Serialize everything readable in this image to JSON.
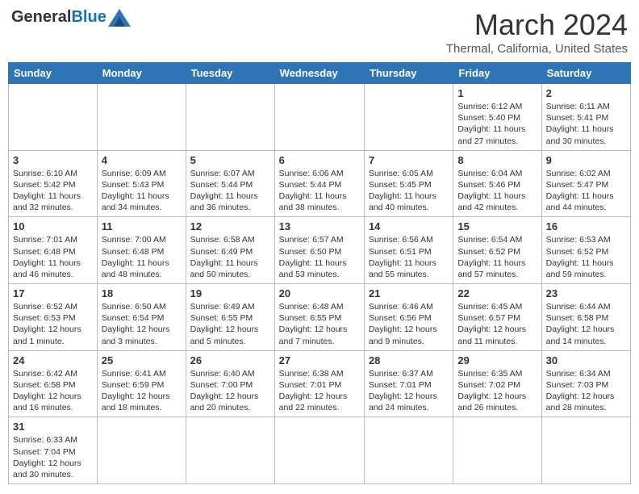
{
  "header": {
    "logo": {
      "general": "General",
      "blue": "Blue"
    },
    "title": "March 2024",
    "location": "Thermal, California, United States"
  },
  "weekdays": [
    "Sunday",
    "Monday",
    "Tuesday",
    "Wednesday",
    "Thursday",
    "Friday",
    "Saturday"
  ],
  "weeks": [
    [
      {
        "day": "",
        "info": ""
      },
      {
        "day": "",
        "info": ""
      },
      {
        "day": "",
        "info": ""
      },
      {
        "day": "",
        "info": ""
      },
      {
        "day": "",
        "info": ""
      },
      {
        "day": "1",
        "info": "Sunrise: 6:12 AM\nSunset: 5:40 PM\nDaylight: 11 hours and 27 minutes."
      },
      {
        "day": "2",
        "info": "Sunrise: 6:11 AM\nSunset: 5:41 PM\nDaylight: 11 hours and 30 minutes."
      }
    ],
    [
      {
        "day": "3",
        "info": "Sunrise: 6:10 AM\nSunset: 5:42 PM\nDaylight: 11 hours and 32 minutes."
      },
      {
        "day": "4",
        "info": "Sunrise: 6:09 AM\nSunset: 5:43 PM\nDaylight: 11 hours and 34 minutes."
      },
      {
        "day": "5",
        "info": "Sunrise: 6:07 AM\nSunset: 5:44 PM\nDaylight: 11 hours and 36 minutes."
      },
      {
        "day": "6",
        "info": "Sunrise: 6:06 AM\nSunset: 5:44 PM\nDaylight: 11 hours and 38 minutes."
      },
      {
        "day": "7",
        "info": "Sunrise: 6:05 AM\nSunset: 5:45 PM\nDaylight: 11 hours and 40 minutes."
      },
      {
        "day": "8",
        "info": "Sunrise: 6:04 AM\nSunset: 5:46 PM\nDaylight: 11 hours and 42 minutes."
      },
      {
        "day": "9",
        "info": "Sunrise: 6:02 AM\nSunset: 5:47 PM\nDaylight: 11 hours and 44 minutes."
      }
    ],
    [
      {
        "day": "10",
        "info": "Sunrise: 7:01 AM\nSunset: 6:48 PM\nDaylight: 11 hours and 46 minutes."
      },
      {
        "day": "11",
        "info": "Sunrise: 7:00 AM\nSunset: 6:48 PM\nDaylight: 11 hours and 48 minutes."
      },
      {
        "day": "12",
        "info": "Sunrise: 6:58 AM\nSunset: 6:49 PM\nDaylight: 11 hours and 50 minutes."
      },
      {
        "day": "13",
        "info": "Sunrise: 6:57 AM\nSunset: 6:50 PM\nDaylight: 11 hours and 53 minutes."
      },
      {
        "day": "14",
        "info": "Sunrise: 6:56 AM\nSunset: 6:51 PM\nDaylight: 11 hours and 55 minutes."
      },
      {
        "day": "15",
        "info": "Sunrise: 6:54 AM\nSunset: 6:52 PM\nDaylight: 11 hours and 57 minutes."
      },
      {
        "day": "16",
        "info": "Sunrise: 6:53 AM\nSunset: 6:52 PM\nDaylight: 11 hours and 59 minutes."
      }
    ],
    [
      {
        "day": "17",
        "info": "Sunrise: 6:52 AM\nSunset: 6:53 PM\nDaylight: 12 hours and 1 minute."
      },
      {
        "day": "18",
        "info": "Sunrise: 6:50 AM\nSunset: 6:54 PM\nDaylight: 12 hours and 3 minutes."
      },
      {
        "day": "19",
        "info": "Sunrise: 6:49 AM\nSunset: 6:55 PM\nDaylight: 12 hours and 5 minutes."
      },
      {
        "day": "20",
        "info": "Sunrise: 6:48 AM\nSunset: 6:55 PM\nDaylight: 12 hours and 7 minutes."
      },
      {
        "day": "21",
        "info": "Sunrise: 6:46 AM\nSunset: 6:56 PM\nDaylight: 12 hours and 9 minutes."
      },
      {
        "day": "22",
        "info": "Sunrise: 6:45 AM\nSunset: 6:57 PM\nDaylight: 12 hours and 11 minutes."
      },
      {
        "day": "23",
        "info": "Sunrise: 6:44 AM\nSunset: 6:58 PM\nDaylight: 12 hours and 14 minutes."
      }
    ],
    [
      {
        "day": "24",
        "info": "Sunrise: 6:42 AM\nSunset: 6:58 PM\nDaylight: 12 hours and 16 minutes."
      },
      {
        "day": "25",
        "info": "Sunrise: 6:41 AM\nSunset: 6:59 PM\nDaylight: 12 hours and 18 minutes."
      },
      {
        "day": "26",
        "info": "Sunrise: 6:40 AM\nSunset: 7:00 PM\nDaylight: 12 hours and 20 minutes."
      },
      {
        "day": "27",
        "info": "Sunrise: 6:38 AM\nSunset: 7:01 PM\nDaylight: 12 hours and 22 minutes."
      },
      {
        "day": "28",
        "info": "Sunrise: 6:37 AM\nSunset: 7:01 PM\nDaylight: 12 hours and 24 minutes."
      },
      {
        "day": "29",
        "info": "Sunrise: 6:35 AM\nSunset: 7:02 PM\nDaylight: 12 hours and 26 minutes."
      },
      {
        "day": "30",
        "info": "Sunrise: 6:34 AM\nSunset: 7:03 PM\nDaylight: 12 hours and 28 minutes."
      }
    ],
    [
      {
        "day": "31",
        "info": "Sunrise: 6:33 AM\nSunset: 7:04 PM\nDaylight: 12 hours and 30 minutes."
      },
      {
        "day": "",
        "info": ""
      },
      {
        "day": "",
        "info": ""
      },
      {
        "day": "",
        "info": ""
      },
      {
        "day": "",
        "info": ""
      },
      {
        "day": "",
        "info": ""
      },
      {
        "day": "",
        "info": ""
      }
    ]
  ]
}
